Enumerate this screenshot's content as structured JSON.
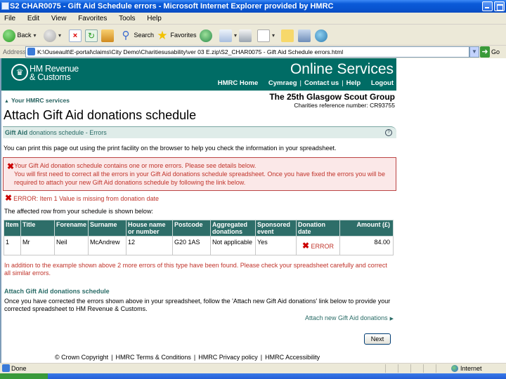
{
  "browser": {
    "window_title": "S2 CHAR0075 - Gift Aid Schedule errors - Microsoft Internet Explorer provided by HMRC",
    "menu": [
      "File",
      "Edit",
      "View",
      "Favorites",
      "Tools",
      "Help"
    ],
    "toolbar": {
      "back_label": "Back",
      "search_label": "Search",
      "favorites_label": "Favorites"
    },
    "address_label": "Address",
    "address_value": "K:\\Ouseault\\E-portal\\claims\\City Demo\\Charitiesusability\\ver 03 E.zip\\S2_CHAR0075 - Gift Aid Schedule errors.html",
    "go_label": "Go",
    "status_text": "Done",
    "zone_text": "Internet"
  },
  "header": {
    "brand_line1": "HM Revenue",
    "brand_line2": "& Customs",
    "online_services": "Online Services",
    "links": {
      "home": "HMRC Home",
      "cymraeg": "Cymraeg",
      "contact": "Contact us",
      "help": "Help",
      "logout": "Logout"
    },
    "separator": "|"
  },
  "nav": {
    "your_services": "Your HMRC services",
    "org_name": "The 25th Glasgow Scout Group",
    "charity_ref": "Charities reference number: CR93755"
  },
  "main": {
    "page_title": "Attach Gift Aid donations schedule",
    "section_title_bold": "Gift Aid",
    "section_title_rest": " donations schedule - Errors",
    "print_note": "You can print this page out using the print facility on the browser to help you check the information in your spreadsheet.",
    "error_summary_line1": "Your Gift Aid donation schedule contains one or more errors. Please see details below.",
    "error_summary_line2": "You will first need to correct all the errors in your Gift Aid donations schedule spreadsheet. Once you have fixed the errors you will be required to attach your new Gift Aid donations schedule by following the link below.",
    "item_error": "ERROR: Item 1 Value is missing from donation date",
    "affected_row_intro": "The affected row from your schedule is shown below:",
    "table": {
      "headers": [
        "Item",
        "Title",
        "Forename",
        "Surname",
        "House name or number",
        "Postcode",
        "Aggregated donations",
        "Sponsored event",
        "Donation date",
        "Amount (£)"
      ],
      "rows": [
        {
          "item": "1",
          "title": "Mr",
          "forename": "Neil",
          "surname": "McAndrew",
          "house": "12",
          "postcode": "G20 1AS",
          "aggregated": "Not applicable",
          "sponsored": "Yes",
          "donation_date": "ERROR",
          "amount": "84.00"
        }
      ]
    },
    "more_errors": "In addition to the example shown above 2 more errors of this type have been found. Please check your spreadsheet carefully and correct all similar errors.",
    "attach_heading": "Attach Gift Aid donations schedule",
    "attach_text": "Once you have corrected the errors shown above in your spreadsheet, follow the 'Attach new Gift Aid donations' link below to provide your corrected spreadsheet to HM Revenue & Customs.",
    "attach_link": "Attach new Gift Aid donations",
    "next_button": "Next"
  },
  "footer": {
    "copyright": "© Crown Copyright",
    "terms": "HMRC Terms & Conditions",
    "privacy": "HMRC Privacy policy",
    "accessibility": "HMRC Accessibility",
    "separator": "|"
  },
  "colors": {
    "hmrc_green": "#006c65",
    "error_red": "#c0332a",
    "error_bg": "#fbe8e8",
    "table_header": "#2e6e69"
  }
}
